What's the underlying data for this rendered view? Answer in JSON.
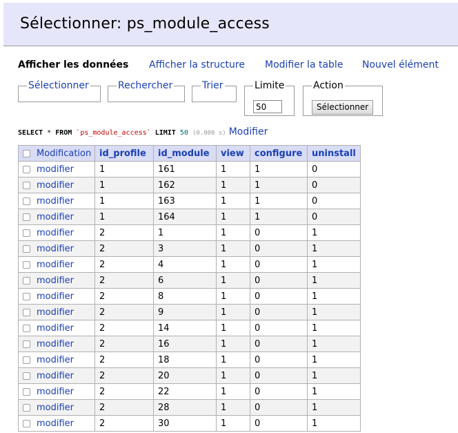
{
  "header": {
    "title": "Sélectionner: ps_module_access"
  },
  "nav": {
    "active": "Afficher les données",
    "links": [
      "Afficher la structure",
      "Modifier la table",
      "Nouvel élément"
    ]
  },
  "filters": {
    "select_label": "Sélectionner",
    "search_label": "Rechercher",
    "sort_label": "Trier",
    "limit_label": "Limite",
    "limit_value": "50",
    "action_label": "Action",
    "action_button": "Sélectionner"
  },
  "sql": {
    "select": "SELECT",
    "star": " * ",
    "from": "FROM",
    "table": "`ps_module_access`",
    "limit": "LIMIT",
    "limit_num": "50",
    "time": "(0.000 s)",
    "edit_link": "Modifier"
  },
  "table": {
    "headers": [
      "Modification",
      "id_profile",
      "id_module",
      "view",
      "configure",
      "uninstall"
    ],
    "row_action": "modifier",
    "rows": [
      [
        "1",
        "161",
        "1",
        "1",
        "0"
      ],
      [
        "1",
        "162",
        "1",
        "1",
        "0"
      ],
      [
        "1",
        "163",
        "1",
        "1",
        "0"
      ],
      [
        "1",
        "164",
        "1",
        "1",
        "0"
      ],
      [
        "2",
        "1",
        "1",
        "0",
        "1"
      ],
      [
        "2",
        "3",
        "1",
        "0",
        "1"
      ],
      [
        "2",
        "4",
        "1",
        "0",
        "1"
      ],
      [
        "2",
        "6",
        "1",
        "0",
        "1"
      ],
      [
        "2",
        "8",
        "1",
        "0",
        "1"
      ],
      [
        "2",
        "9",
        "1",
        "0",
        "1"
      ],
      [
        "2",
        "14",
        "1",
        "0",
        "1"
      ],
      [
        "2",
        "16",
        "1",
        "0",
        "1"
      ],
      [
        "2",
        "18",
        "1",
        "0",
        "1"
      ],
      [
        "2",
        "20",
        "1",
        "0",
        "1"
      ],
      [
        "2",
        "22",
        "1",
        "0",
        "1"
      ],
      [
        "2",
        "28",
        "1",
        "0",
        "1"
      ],
      [
        "2",
        "30",
        "1",
        "0",
        "1"
      ]
    ]
  }
}
